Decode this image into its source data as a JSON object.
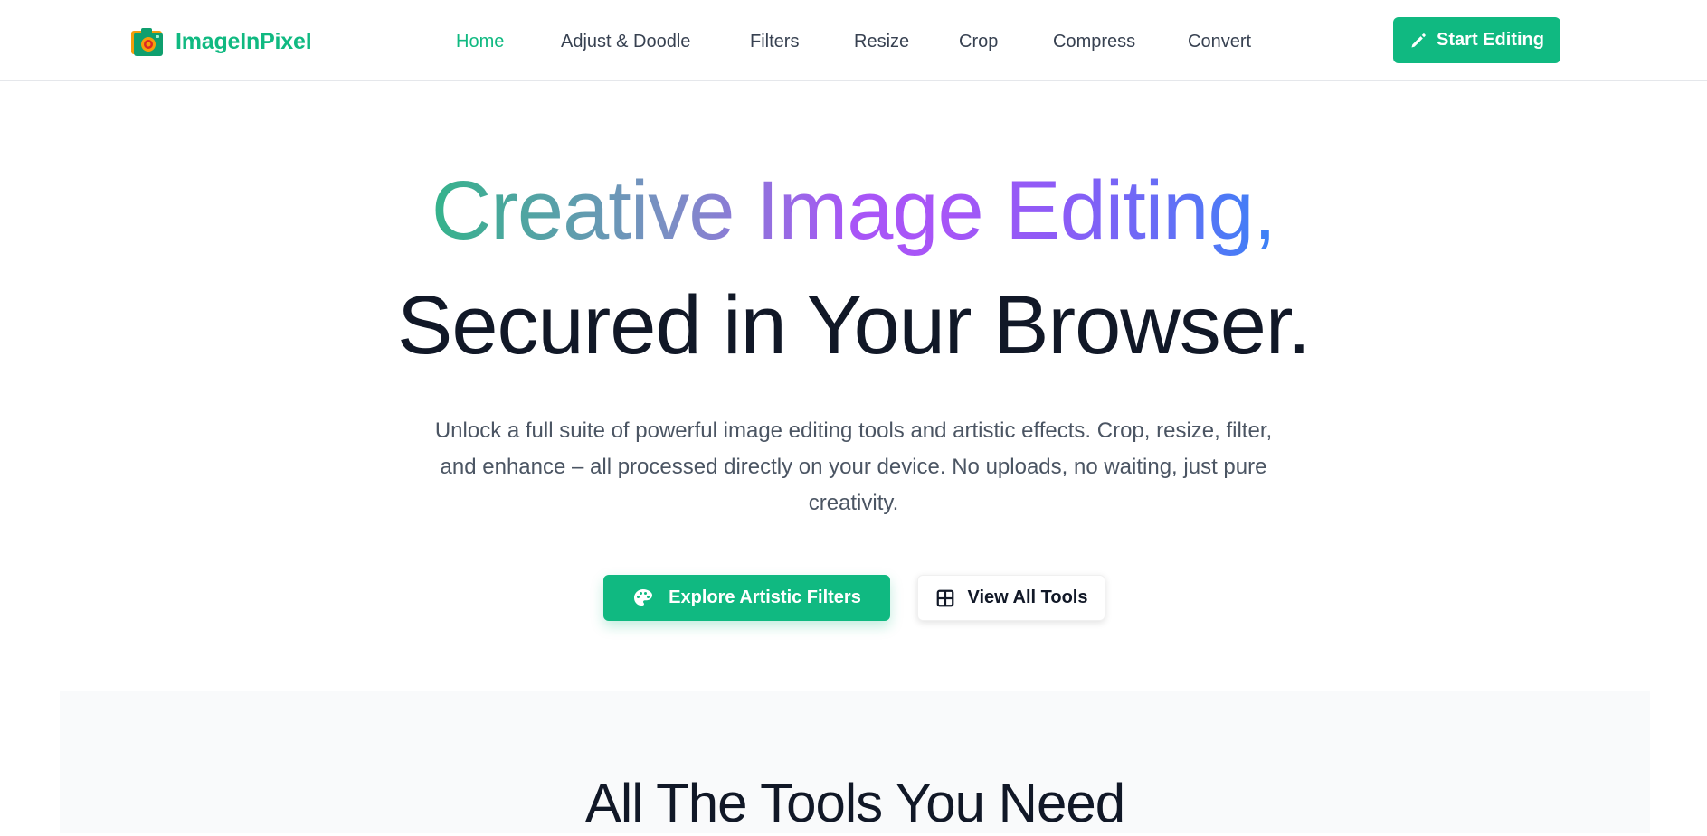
{
  "brand": {
    "name": "ImageInPixel",
    "accent": "#10b981"
  },
  "nav": {
    "items": [
      {
        "label": "Home",
        "active": true
      },
      {
        "label": "Adjust & Doodle",
        "active": false
      },
      {
        "label": "Filters",
        "active": false
      },
      {
        "label": "Resize",
        "active": false
      },
      {
        "label": "Crop",
        "active": false
      },
      {
        "label": "Compress",
        "active": false
      },
      {
        "label": "Convert",
        "active": false
      }
    ],
    "cta_label": "Start Editing",
    "cta_icon": "pencil-icon"
  },
  "hero": {
    "title_gradient": "Creative Image Editing,",
    "title_plain": "Secured in Your Browser.",
    "subtitle": "Unlock a full suite of powerful image editing tools and artistic effects. Crop, resize, filter, and enhance – all processed directly on your device. No uploads, no waiting, just pure creativity.",
    "primary_button": {
      "label": "Explore Artistic Filters",
      "icon": "palette-icon"
    },
    "secondary_button": {
      "label": "View All Tools",
      "icon": "grid-icon"
    }
  },
  "tools_section": {
    "title": "All The Tools You Need"
  }
}
